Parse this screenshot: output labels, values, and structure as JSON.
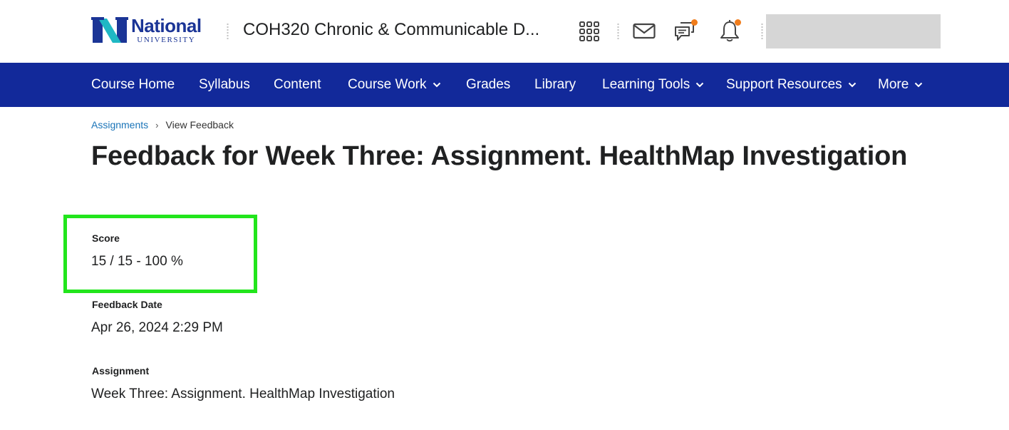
{
  "header": {
    "logo": {
      "name": "National",
      "subtitle": "UNIVERSITY"
    },
    "course_title": "COH320 Chronic & Communicable D...",
    "icons": [
      {
        "name": "apps-grid-icon"
      },
      {
        "name": "mail-icon"
      },
      {
        "name": "chat-icon",
        "badge": true
      },
      {
        "name": "bell-icon",
        "badge": true
      }
    ],
    "badge_color": "#f07c1b"
  },
  "nav": {
    "color": "#12299a",
    "items": [
      {
        "label": "Course Home",
        "dropdown": false
      },
      {
        "label": "Syllabus",
        "dropdown": false
      },
      {
        "label": "Content",
        "dropdown": false
      },
      {
        "label": "Course Work",
        "dropdown": true
      },
      {
        "label": "Grades",
        "dropdown": false
      },
      {
        "label": "Library",
        "dropdown": false
      },
      {
        "label": "Learning Tools",
        "dropdown": true
      },
      {
        "label": "Support Resources",
        "dropdown": true
      },
      {
        "label": "More",
        "dropdown": true
      }
    ]
  },
  "breadcrumb": {
    "link": "Assignments",
    "separator": "›",
    "current": "View Feedback"
  },
  "page": {
    "title": "Feedback for Week Three: Assignment. HealthMap Investigation",
    "fields": [
      {
        "label": "Score",
        "value": "15 / 15 - 100 %"
      },
      {
        "label": "Feedback Date",
        "value": "Apr 26, 2024 2:29 PM"
      },
      {
        "label": "Assignment",
        "value": "Week Three: Assignment. HealthMap Investigation"
      }
    ],
    "highlight_color": "#22e51c"
  }
}
